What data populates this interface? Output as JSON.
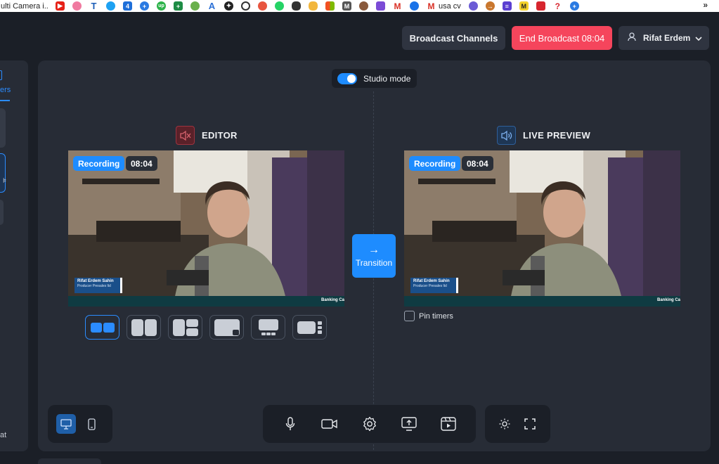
{
  "browser": {
    "bookmarks_title": "ulti Camera i...",
    "bookmark_text": "usa cv",
    "more": "»"
  },
  "header": {
    "broadcast_channels": "Broadcast Channels",
    "end_broadcast": "End Broadcast 08:04",
    "user_name": "Rifat Erdem"
  },
  "sidebar": {
    "tab_label": "ers",
    "bottom_text": "at"
  },
  "studio": {
    "mode_label": "Studio mode",
    "mode_enabled": true
  },
  "editor": {
    "title": "EDITOR",
    "recording_badge": "Recording",
    "timer": "08:04",
    "lower_third_name": "Rifat Erdem Sahin",
    "lower_third_subtitle": "Producer Presales ltd",
    "ticker": "Banking Ca"
  },
  "live": {
    "title": "LIVE PREVIEW",
    "recording_badge": "Recording",
    "timer": "08:04",
    "lower_third_name": "Rifat Erdem Sahin",
    "lower_third_subtitle": "Producer Presales ltd",
    "ticker": "Banking Ca",
    "pin_timers": "Pin timers"
  },
  "transition": {
    "arrow": "→",
    "label": "Transition"
  },
  "colors": {
    "accent": "#1e8cff",
    "end_broadcast": "#f5455c",
    "panel": "#272c36",
    "background": "#1b1f27"
  }
}
